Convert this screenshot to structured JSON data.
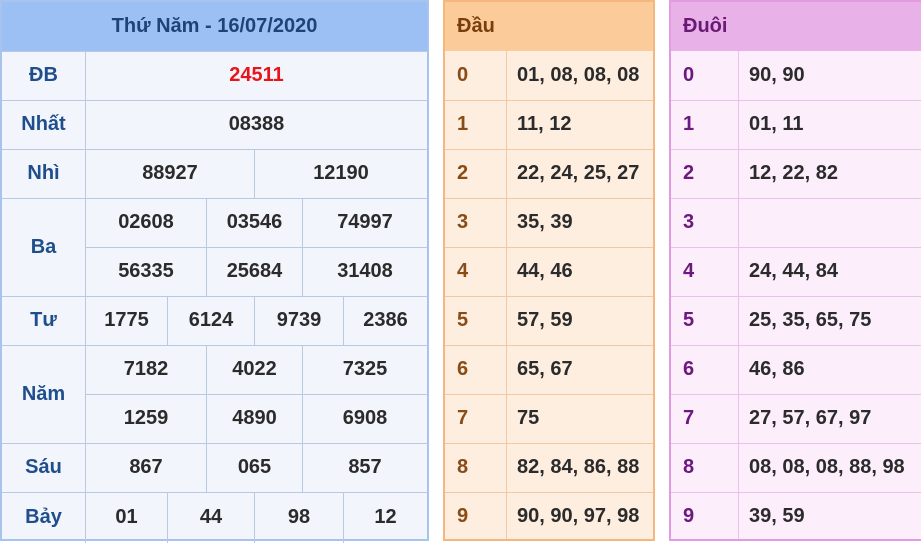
{
  "results": {
    "title": "Thứ Năm - 16/07/2020",
    "rows": [
      {
        "label": "ĐB",
        "values": [
          "24511"
        ]
      },
      {
        "label": "Nhất",
        "values": [
          "08388"
        ]
      },
      {
        "label": "Nhì",
        "values": [
          "88927",
          "12190"
        ]
      },
      {
        "label": "Ba",
        "values": [
          "02608",
          "03546",
          "74997",
          "56335",
          "25684",
          "31408"
        ]
      },
      {
        "label": "Tư",
        "values": [
          "1775",
          "6124",
          "9739",
          "2386"
        ]
      },
      {
        "label": "Năm",
        "values": [
          "7182",
          "4022",
          "7325",
          "1259",
          "4890",
          "6908"
        ]
      },
      {
        "label": "Sáu",
        "values": [
          "867",
          "065",
          "857"
        ]
      },
      {
        "label": "Bảy",
        "values": [
          "01",
          "44",
          "98",
          "12"
        ]
      }
    ]
  },
  "dau": {
    "title": "Đầu",
    "rows": [
      {
        "key": "0",
        "values": "01, 08, 08, 08"
      },
      {
        "key": "1",
        "values": "11, 12"
      },
      {
        "key": "2",
        "values": "22, 24, 25, 27"
      },
      {
        "key": "3",
        "values": "35, 39"
      },
      {
        "key": "4",
        "values": "44, 46"
      },
      {
        "key": "5",
        "values": "57, 59"
      },
      {
        "key": "6",
        "values": "65, 67"
      },
      {
        "key": "7",
        "values": "75"
      },
      {
        "key": "8",
        "values": "82, 84, 86, 88"
      },
      {
        "key": "9",
        "values": "90, 90, 97, 98"
      }
    ]
  },
  "duoi": {
    "title": "Đuôi",
    "rows": [
      {
        "key": "0",
        "values": "90, 90"
      },
      {
        "key": "1",
        "values": "01, 11"
      },
      {
        "key": "2",
        "values": "12, 22, 82"
      },
      {
        "key": "3",
        "values": ""
      },
      {
        "key": "4",
        "values": "24, 44, 84"
      },
      {
        "key": "5",
        "values": "25, 35, 65, 75"
      },
      {
        "key": "6",
        "values": "46, 86"
      },
      {
        "key": "7",
        "values": "27, 57, 67, 97"
      },
      {
        "key": "8",
        "values": "08, 08, 08, 88, 98"
      },
      {
        "key": "9",
        "values": "39, 59"
      }
    ]
  },
  "colors": {
    "special_prize": "#e8141a",
    "results_header": "#9dc0f4",
    "dau_header": "#fbcb9a",
    "duoi_header": "#e8b2e8"
  }
}
